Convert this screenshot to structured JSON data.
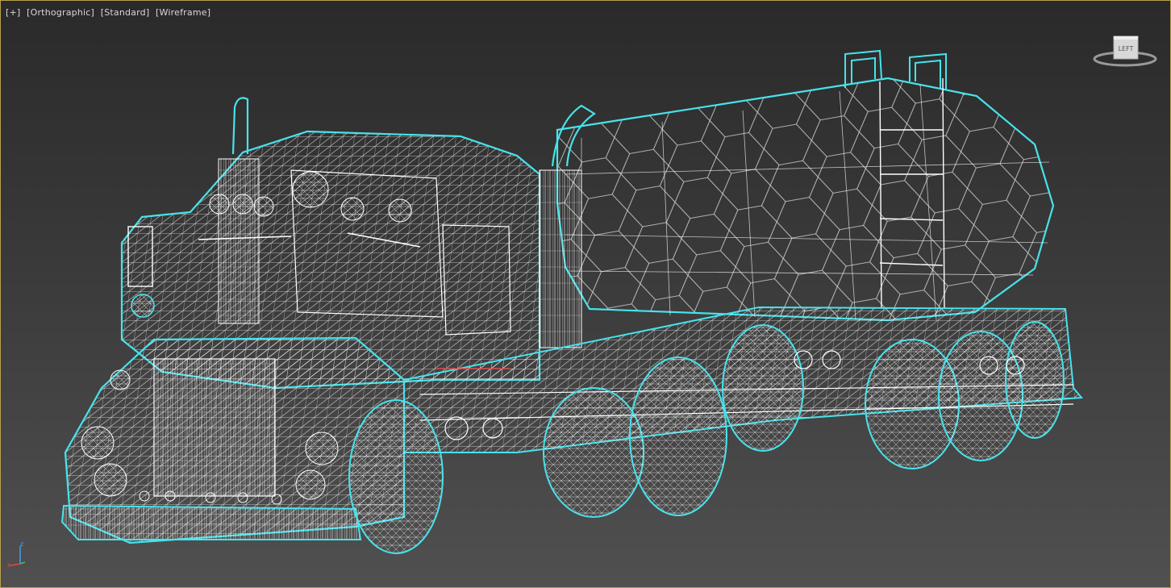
{
  "viewport": {
    "plus_label": "[+]",
    "projection_label": "[Orthographic]",
    "shading_style_label": "[Standard]",
    "display_mode_label": "[Wireframe]"
  },
  "viewcube": {
    "face_label": "LEFT"
  },
  "axis": {
    "z_label": "z",
    "x_label": "x"
  },
  "colors": {
    "border": "#b8a24a",
    "selection_outline": "#47e3ec",
    "wire": "#ffffff",
    "background_top": "#2a2a2a",
    "background_bottom": "#505050"
  }
}
